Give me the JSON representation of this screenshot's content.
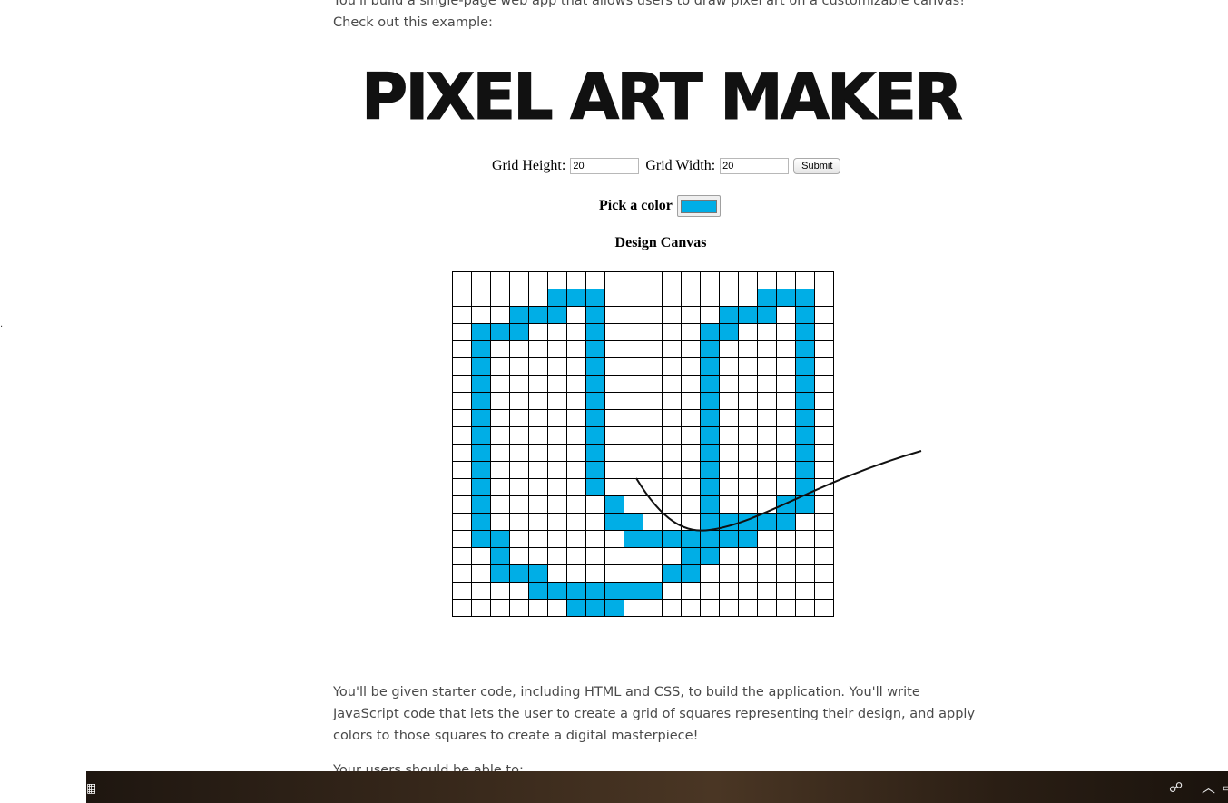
{
  "intro_text": "You'll build a single-page web app that allows users to draw pixel art on a customizable canvas! Check out this example:",
  "logo_text": "PIXEL ART MAKER",
  "form": {
    "height_label": "Grid Height:",
    "height_value": "20",
    "width_label": "Grid Width:",
    "width_value": "20",
    "submit_label": "Submit"
  },
  "color_picker": {
    "label": "Pick a color",
    "value": "#00aee6"
  },
  "canvas_title": "Design Canvas",
  "grid": {
    "rows": 20,
    "cols": 20,
    "fill_color": "#00aee6",
    "filled_cells": [
      [
        1,
        5
      ],
      [
        1,
        6
      ],
      [
        1,
        7
      ],
      [
        1,
        16
      ],
      [
        1,
        17
      ],
      [
        1,
        18
      ],
      [
        2,
        3
      ],
      [
        2,
        4
      ],
      [
        2,
        5
      ],
      [
        2,
        7
      ],
      [
        2,
        14
      ],
      [
        2,
        15
      ],
      [
        2,
        16
      ],
      [
        2,
        18
      ],
      [
        3,
        1
      ],
      [
        3,
        2
      ],
      [
        3,
        3
      ],
      [
        3,
        7
      ],
      [
        3,
        13
      ],
      [
        3,
        14
      ],
      [
        3,
        18
      ],
      [
        4,
        1
      ],
      [
        4,
        7
      ],
      [
        4,
        13
      ],
      [
        4,
        18
      ],
      [
        5,
        1
      ],
      [
        5,
        7
      ],
      [
        5,
        13
      ],
      [
        5,
        18
      ],
      [
        6,
        1
      ],
      [
        6,
        7
      ],
      [
        6,
        13
      ],
      [
        6,
        18
      ],
      [
        7,
        1
      ],
      [
        7,
        7
      ],
      [
        7,
        13
      ],
      [
        7,
        18
      ],
      [
        8,
        1
      ],
      [
        8,
        7
      ],
      [
        8,
        13
      ],
      [
        8,
        18
      ],
      [
        9,
        1
      ],
      [
        9,
        7
      ],
      [
        9,
        13
      ],
      [
        9,
        18
      ],
      [
        10,
        1
      ],
      [
        10,
        7
      ],
      [
        10,
        13
      ],
      [
        10,
        18
      ],
      [
        11,
        1
      ],
      [
        11,
        7
      ],
      [
        11,
        13
      ],
      [
        11,
        18
      ],
      [
        12,
        1
      ],
      [
        12,
        7
      ],
      [
        12,
        13
      ],
      [
        12,
        18
      ],
      [
        13,
        1
      ],
      [
        13,
        8
      ],
      [
        13,
        13
      ],
      [
        13,
        17
      ],
      [
        13,
        18
      ],
      [
        14,
        1
      ],
      [
        14,
        8
      ],
      [
        14,
        9
      ],
      [
        14,
        13
      ],
      [
        14,
        14
      ],
      [
        14,
        15
      ],
      [
        14,
        16
      ],
      [
        14,
        17
      ],
      [
        15,
        1
      ],
      [
        15,
        2
      ],
      [
        15,
        9
      ],
      [
        15,
        10
      ],
      [
        15,
        11
      ],
      [
        15,
        12
      ],
      [
        15,
        13
      ],
      [
        15,
        14
      ],
      [
        15,
        15
      ],
      [
        16,
        2
      ],
      [
        16,
        12
      ],
      [
        16,
        13
      ],
      [
        17,
        2
      ],
      [
        17,
        3
      ],
      [
        17,
        4
      ],
      [
        17,
        11
      ],
      [
        17,
        12
      ],
      [
        18,
        4
      ],
      [
        18,
        5
      ],
      [
        18,
        6
      ],
      [
        18,
        7
      ],
      [
        18,
        8
      ],
      [
        18,
        9
      ],
      [
        18,
        10
      ],
      [
        19,
        6
      ],
      [
        19,
        7
      ],
      [
        19,
        8
      ]
    ]
  },
  "body_text": "You'll be given starter code, including HTML and CSS, to build the application. You'll write JavaScript code that lets the user to create a grid of squares representing their design, and apply colors to those squares to create a digital masterpiece!",
  "users_text": "Your users should be able to:",
  "taskbar": {
    "left_icon": "calculator-icon",
    "people_icon": "people-icon",
    "chevron_icon": "chevron-up-icon"
  }
}
